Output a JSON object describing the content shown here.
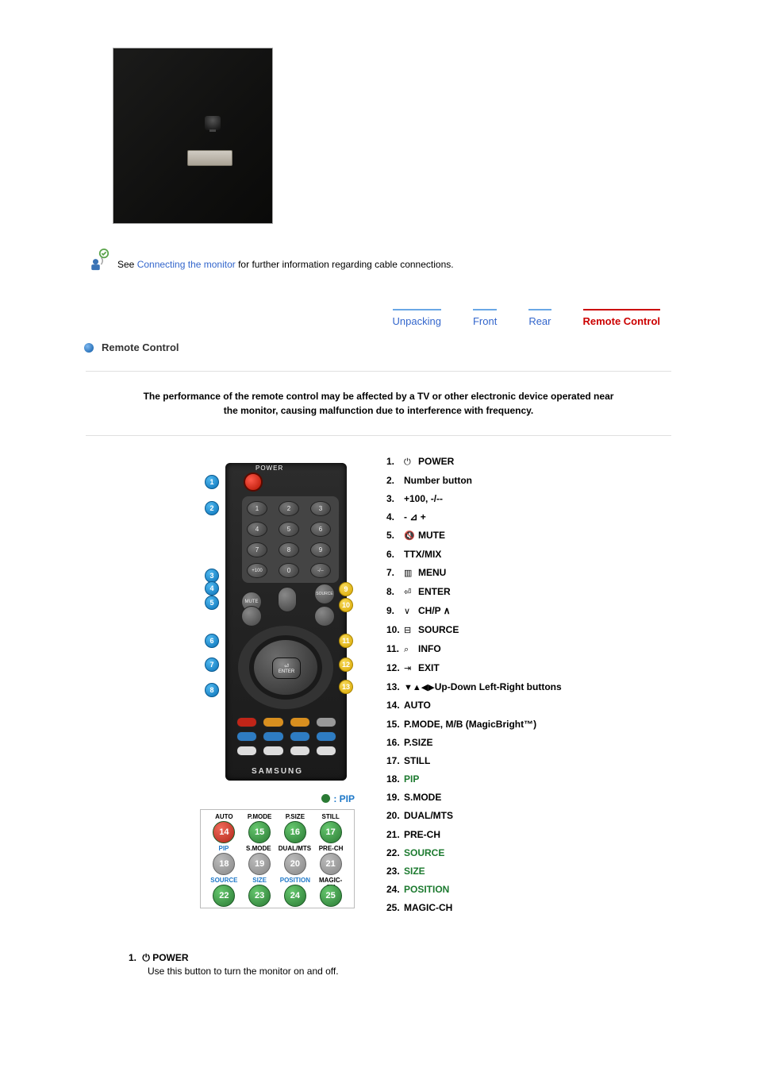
{
  "info": {
    "prefix": "See ",
    "link": "Connecting the monitor",
    "suffix": " for further information regarding cable connections."
  },
  "tabs": [
    {
      "label": "Unpacking",
      "active": false
    },
    {
      "label": "Front",
      "active": false
    },
    {
      "label": "Rear",
      "active": false
    },
    {
      "label": "Remote Control",
      "active": true
    }
  ],
  "section_title": "Remote Control",
  "warning_line1": "The performance of the remote control may be affected by a TV or other electronic device operated near",
  "warning_line2": "the monitor, causing malfunction due to interference with frequency.",
  "remote_brand": "SAMSUNG",
  "pip_legend": ": PIP",
  "callouts_left": [
    "1",
    "2",
    "3",
    "4",
    "5",
    "6",
    "7",
    "8"
  ],
  "callouts_right": [
    "9",
    "10",
    "11",
    "12",
    "13"
  ],
  "detail_labels_top": [
    "AUTO",
    "P.MODE",
    "P.SIZE",
    "STILL"
  ],
  "detail_nums_top": [
    "14",
    "15",
    "16",
    "17"
  ],
  "detail_labels_mid": [
    "PIP",
    "S.MODE",
    "DUAL/MTS",
    "PRE-CH"
  ],
  "detail_nums_mid": [
    "18",
    "19",
    "20",
    "21"
  ],
  "detail_labels_bot": [
    "SOURCE",
    "SIZE",
    "POSITION",
    "MAGIC-CH"
  ],
  "detail_nums_bot": [
    "22",
    "23",
    "24",
    "25"
  ],
  "list": [
    {
      "n": "1.",
      "icon": "⏻",
      "label": "POWER",
      "link": false
    },
    {
      "n": "2.",
      "icon": "",
      "label": "Number button",
      "link": false
    },
    {
      "n": "3.",
      "icon": "",
      "label": "+100, -/--",
      "link": false
    },
    {
      "n": "4.",
      "icon": "",
      "label": "- ⊿ +",
      "link": false
    },
    {
      "n": "5.",
      "icon": "🔇",
      "label": "MUTE",
      "link": false
    },
    {
      "n": "6.",
      "icon": "",
      "label": "TTX/MIX",
      "link": false
    },
    {
      "n": "7.",
      "icon": "▥",
      "label": "MENU",
      "link": false
    },
    {
      "n": "8.",
      "icon": "⏎",
      "label": "ENTER",
      "link": false
    },
    {
      "n": "9.",
      "icon": "∨",
      "label": "CH/P ∧",
      "link": false
    },
    {
      "n": "10.",
      "icon": "⊟",
      "label": "SOURCE",
      "link": false
    },
    {
      "n": "11.",
      "icon": "⌕",
      "label": "INFO",
      "link": false
    },
    {
      "n": "12.",
      "icon": "⇥",
      "label": "EXIT",
      "link": false
    },
    {
      "n": "13.",
      "icon": "▼▲◀▶",
      "label": "Up-Down Left-Right buttons",
      "link": false
    },
    {
      "n": "14.",
      "icon": "",
      "label": "AUTO",
      "link": false
    },
    {
      "n": "15.",
      "icon": "",
      "label": "P.MODE, M/B (MagicBright™)",
      "link": false
    },
    {
      "n": "16.",
      "icon": "",
      "label": "P.SIZE",
      "link": false
    },
    {
      "n": "17.",
      "icon": "",
      "label": "STILL",
      "link": false
    },
    {
      "n": "18.",
      "icon": "",
      "label": "PIP",
      "link": true
    },
    {
      "n": "19.",
      "icon": "",
      "label": "S.MODE",
      "link": false
    },
    {
      "n": "20.",
      "icon": "",
      "label": "DUAL/MTS",
      "link": false
    },
    {
      "n": "21.",
      "icon": "",
      "label": "PRE-CH",
      "link": false
    },
    {
      "n": "22.",
      "icon": "",
      "label": "SOURCE",
      "link": true
    },
    {
      "n": "23.",
      "icon": "",
      "label": "SIZE",
      "link": true
    },
    {
      "n": "24.",
      "icon": "",
      "label": "POSITION",
      "link": true
    },
    {
      "n": "25.",
      "icon": "",
      "label": "MAGIC-CH",
      "link": false
    }
  ],
  "footer": {
    "num": "1.",
    "icon": "⏻",
    "title": "POWER",
    "desc": "Use this button to turn the monitor on and off."
  }
}
